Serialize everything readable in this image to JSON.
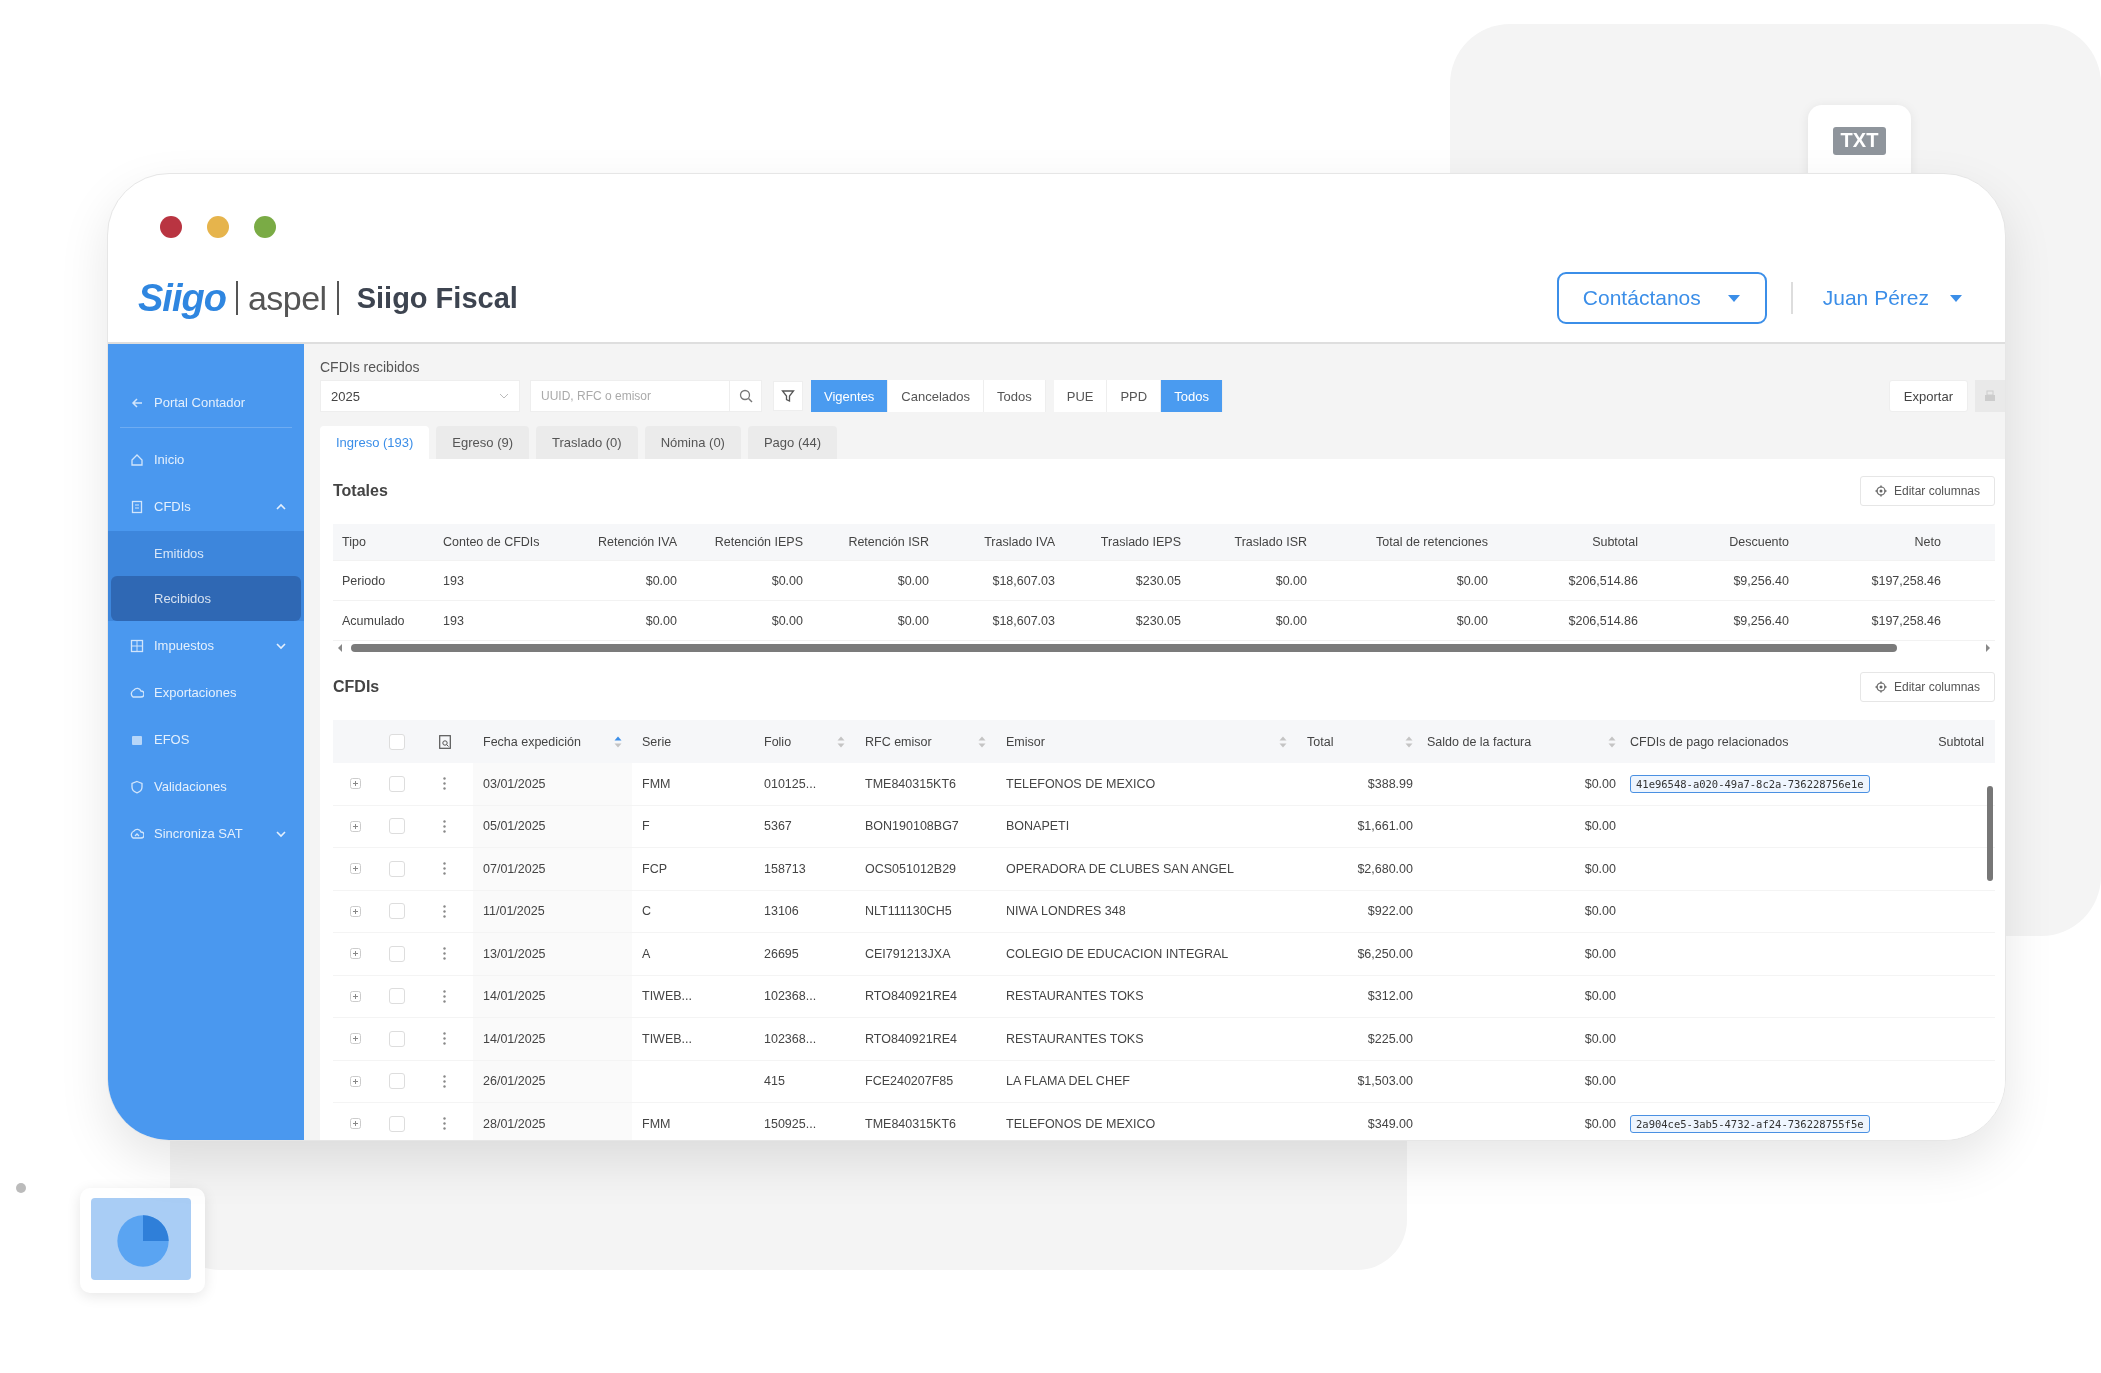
{
  "decorations": {
    "file_badge": "TXT"
  },
  "header": {
    "brand": "Siigo",
    "partner": "aspel",
    "app_title": "Siigo Fiscal",
    "contact_button": "Contáctanos",
    "user": "Juan Pérez"
  },
  "sidebar": {
    "items": [
      {
        "label": "Portal Contador",
        "kind": "back",
        "selected": false
      },
      {
        "label": "Inicio",
        "kind": "link",
        "selected": false
      },
      {
        "label": "CFDIs",
        "kind": "group",
        "selected": false,
        "expanded": true,
        "children": [
          {
            "label": "Emitidos",
            "selected": false
          },
          {
            "label": "Recibidos",
            "selected": true
          }
        ]
      },
      {
        "label": "Impuestos",
        "kind": "group",
        "selected": false,
        "expanded": false
      },
      {
        "label": "Exportaciones",
        "kind": "link",
        "selected": false
      },
      {
        "label": "EFOS",
        "kind": "link",
        "selected": false
      },
      {
        "label": "Validaciones",
        "kind": "link",
        "selected": false
      },
      {
        "label": "Sincroniza SAT",
        "kind": "group",
        "selected": false,
        "expanded": false
      }
    ]
  },
  "toolbar": {
    "page_title": "CFDIs recibidos",
    "year_select": {
      "value": "2025"
    },
    "search": {
      "placeholder": "UUID, RFC o emisor"
    },
    "status_filter": [
      {
        "label": "Vigentes",
        "selected": true
      },
      {
        "label": "Cancelados",
        "selected": false
      },
      {
        "label": "Todos",
        "selected": false
      }
    ],
    "method_filter": [
      {
        "label": "PUE",
        "selected": false
      },
      {
        "label": "PPD",
        "selected": false
      },
      {
        "label": "Todos",
        "selected": true
      }
    ],
    "export_button": "Exportar"
  },
  "tabs": [
    {
      "label": "Ingreso (193)",
      "selected": true
    },
    {
      "label": "Egreso (9)",
      "selected": false
    },
    {
      "label": "Traslado (0)",
      "selected": false
    },
    {
      "label": "Nómina (0)",
      "selected": false
    },
    {
      "label": "Pago (44)",
      "selected": false
    }
  ],
  "totals": {
    "title": "Totales",
    "edit_button": "Editar columnas",
    "columns": [
      "Tipo",
      "Conteo de CFDIs",
      "Retención IVA",
      "Retención IEPS",
      "Retención ISR",
      "Traslado IVA",
      "Traslado IEPS",
      "Traslado ISR",
      "Total de retenciones",
      "Subtotal",
      "Descuento",
      "Neto"
    ],
    "rows": [
      [
        "Periodo",
        "193",
        "$0.00",
        "$0.00",
        "$0.00",
        "$18,607.03",
        "$230.05",
        "$0.00",
        "$0.00",
        "$206,514.86",
        "$9,256.40",
        "$197,258.46"
      ],
      [
        "Acumulado",
        "193",
        "$0.00",
        "$0.00",
        "$0.00",
        "$18,607.03",
        "$230.05",
        "$0.00",
        "$0.00",
        "$206,514.86",
        "$9,256.40",
        "$197,258.46"
      ]
    ]
  },
  "cfdis": {
    "title": "CFDIs",
    "edit_button": "Editar columnas",
    "select_all_checked": false,
    "columns": [
      {
        "label": "Fecha expedición",
        "sortable": true,
        "sorted": true
      },
      {
        "label": "Serie"
      },
      {
        "label": "Folio",
        "sortable": true,
        "sorted": false
      },
      {
        "label": "RFC emisor",
        "sortable": true,
        "sorted": false
      },
      {
        "label": "Emisor",
        "sortable": true,
        "sorted": false
      },
      {
        "label": "Total",
        "sortable": true,
        "sorted": false
      },
      {
        "label": "Saldo de la factura",
        "sortable": true,
        "sorted": false
      },
      {
        "label": "CFDIs de pago relacionados"
      },
      {
        "label": "Subtotal"
      }
    ],
    "rows": [
      {
        "checked": false,
        "date": "03/01/2025",
        "serie": "FMM",
        "folio": "010125...",
        "rfc": "TME840315KT6",
        "emisor": "TELEFONOS DE MEXICO",
        "total": "$388.99",
        "saldo": "$0.00",
        "pago": "41e96548-a020-49a7-8c2a-736228756e1e"
      },
      {
        "checked": false,
        "date": "05/01/2025",
        "serie": "F",
        "folio": "5367",
        "rfc": "BON190108BG7",
        "emisor": "BONAPETI",
        "total": "$1,661.00",
        "saldo": "$0.00"
      },
      {
        "checked": false,
        "date": "07/01/2025",
        "serie": "FCP",
        "folio": "158713",
        "rfc": "OCS051012B29",
        "emisor": "OPERADORA DE CLUBES SAN ANGEL",
        "total": "$2,680.00",
        "saldo": "$0.00"
      },
      {
        "checked": false,
        "date": "11/01/2025",
        "serie": "C",
        "folio": "13106",
        "rfc": "NLT111130CH5",
        "emisor": "NIWA LONDRES 348",
        "total": "$922.00",
        "saldo": "$0.00"
      },
      {
        "checked": false,
        "date": "13/01/2025",
        "serie": "A",
        "folio": "26695",
        "rfc": "CEI791213JXA",
        "emisor": "COLEGIO DE EDUCACION INTEGRAL",
        "total": "$6,250.00",
        "saldo": "$0.00"
      },
      {
        "checked": false,
        "date": "14/01/2025",
        "serie": "TIWEB...",
        "folio": "102368...",
        "rfc": "RTO840921RE4",
        "emisor": "RESTAURANTES TOKS",
        "total": "$312.00",
        "saldo": "$0.00"
      },
      {
        "checked": false,
        "date": "14/01/2025",
        "serie": "TIWEB...",
        "folio": "102368...",
        "rfc": "RTO840921RE4",
        "emisor": "RESTAURANTES TOKS",
        "total": "$225.00",
        "saldo": "$0.00"
      },
      {
        "checked": false,
        "date": "26/01/2025",
        "folio": "415",
        "rfc": "FCE240207F85",
        "emisor": "LA FLAMA DEL CHEF",
        "total": "$1,503.00",
        "saldo": "$0.00"
      },
      {
        "checked": false,
        "date": "28/01/2025",
        "serie": "FMM",
        "folio": "150925...",
        "rfc": "TME840315KT6",
        "emisor": "TELEFONOS DE MEXICO",
        "total": "$349.00",
        "saldo": "$0.00",
        "pago": "2a904ce5-3ab5-4732-af24-736228755f5e"
      }
    ]
  }
}
